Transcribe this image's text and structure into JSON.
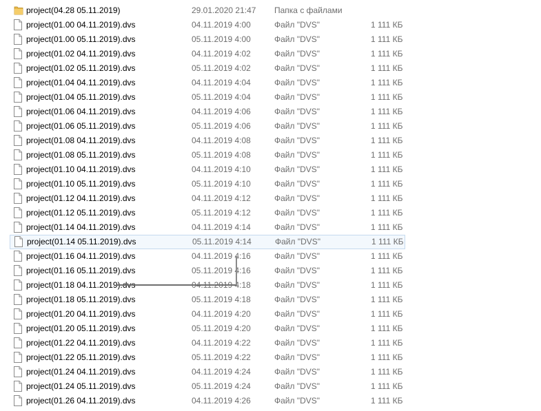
{
  "files": [
    {
      "name": "project(04.28 05.11.2019)",
      "date": "29.01.2020 21:47",
      "type": "Папка с файлами",
      "size": "",
      "icon": "folder-icon"
    },
    {
      "name": "project(01.00 04.11.2019).dvs",
      "date": "04.11.2019 4:00",
      "type": "Файл \"DVS\"",
      "size": "1 111 КБ",
      "icon": "file-icon"
    },
    {
      "name": "project(01.00 05.11.2019).dvs",
      "date": "05.11.2019 4:00",
      "type": "Файл \"DVS\"",
      "size": "1 111 КБ",
      "icon": "file-icon"
    },
    {
      "name": "project(01.02 04.11.2019).dvs",
      "date": "04.11.2019 4:02",
      "type": "Файл \"DVS\"",
      "size": "1 111 КБ",
      "icon": "file-icon"
    },
    {
      "name": "project(01.02 05.11.2019).dvs",
      "date": "05.11.2019 4:02",
      "type": "Файл \"DVS\"",
      "size": "1 111 КБ",
      "icon": "file-icon"
    },
    {
      "name": "project(01.04 04.11.2019).dvs",
      "date": "04.11.2019 4:04",
      "type": "Файл \"DVS\"",
      "size": "1 111 КБ",
      "icon": "file-icon"
    },
    {
      "name": "project(01.04 05.11.2019).dvs",
      "date": "05.11.2019 4:04",
      "type": "Файл \"DVS\"",
      "size": "1 111 КБ",
      "icon": "file-icon"
    },
    {
      "name": "project(01.06 04.11.2019).dvs",
      "date": "04.11.2019 4:06",
      "type": "Файл \"DVS\"",
      "size": "1 111 КБ",
      "icon": "file-icon"
    },
    {
      "name": "project(01.06 05.11.2019).dvs",
      "date": "05.11.2019 4:06",
      "type": "Файл \"DVS\"",
      "size": "1 111 КБ",
      "icon": "file-icon"
    },
    {
      "name": "project(01.08 04.11.2019).dvs",
      "date": "04.11.2019 4:08",
      "type": "Файл \"DVS\"",
      "size": "1 111 КБ",
      "icon": "file-icon"
    },
    {
      "name": "project(01.08 05.11.2019).dvs",
      "date": "05.11.2019 4:08",
      "type": "Файл \"DVS\"",
      "size": "1 111 КБ",
      "icon": "file-icon"
    },
    {
      "name": "project(01.10 04.11.2019).dvs",
      "date": "04.11.2019 4:10",
      "type": "Файл \"DVS\"",
      "size": "1 111 КБ",
      "icon": "file-icon"
    },
    {
      "name": "project(01.10 05.11.2019).dvs",
      "date": "05.11.2019 4:10",
      "type": "Файл \"DVS\"",
      "size": "1 111 КБ",
      "icon": "file-icon"
    },
    {
      "name": "project(01.12 04.11.2019).dvs",
      "date": "04.11.2019 4:12",
      "type": "Файл \"DVS\"",
      "size": "1 111 КБ",
      "icon": "file-icon"
    },
    {
      "name": "project(01.12 05.11.2019).dvs",
      "date": "05.11.2019 4:12",
      "type": "Файл \"DVS\"",
      "size": "1 111 КБ",
      "icon": "file-icon"
    },
    {
      "name": "project(01.14 04.11.2019).dvs",
      "date": "04.11.2019 4:14",
      "type": "Файл \"DVS\"",
      "size": "1 111 КБ",
      "icon": "file-icon"
    },
    {
      "name": "project(01.14 05.11.2019).dvs",
      "date": "05.11.2019 4:14",
      "type": "Файл \"DVS\"",
      "size": "1 111 КБ",
      "icon": "file-icon",
      "selected": true
    },
    {
      "name": "project(01.16 04.11.2019).dvs",
      "date": "04.11.2019 4:16",
      "type": "Файл \"DVS\"",
      "size": "1 111 КБ",
      "icon": "file-icon"
    },
    {
      "name": "project(01.16 05.11.2019).dvs",
      "date": "05.11.2019 4:16",
      "type": "Файл \"DVS\"",
      "size": "1 111 КБ",
      "icon": "file-icon"
    },
    {
      "name": "project(01.18 04.11.2019).dvs",
      "date": "04.11.2019 4:18",
      "type": "Файл \"DVS\"",
      "size": "1 111 КБ",
      "icon": "file-icon"
    },
    {
      "name": "project(01.18 05.11.2019).dvs",
      "date": "05.11.2019 4:18",
      "type": "Файл \"DVS\"",
      "size": "1 111 КБ",
      "icon": "file-icon"
    },
    {
      "name": "project(01.20 04.11.2019).dvs",
      "date": "04.11.2019 4:20",
      "type": "Файл \"DVS\"",
      "size": "1 111 КБ",
      "icon": "file-icon"
    },
    {
      "name": "project(01.20 05.11.2019).dvs",
      "date": "05.11.2019 4:20",
      "type": "Файл \"DVS\"",
      "size": "1 111 КБ",
      "icon": "file-icon"
    },
    {
      "name": "project(01.22 04.11.2019).dvs",
      "date": "04.11.2019 4:22",
      "type": "Файл \"DVS\"",
      "size": "1 111 КБ",
      "icon": "file-icon"
    },
    {
      "name": "project(01.22 05.11.2019).dvs",
      "date": "05.11.2019 4:22",
      "type": "Файл \"DVS\"",
      "size": "1 111 КБ",
      "icon": "file-icon"
    },
    {
      "name": "project(01.24 04.11.2019).dvs",
      "date": "04.11.2019 4:24",
      "type": "Файл \"DVS\"",
      "size": "1 111 КБ",
      "icon": "file-icon"
    },
    {
      "name": "project(01.24 05.11.2019).dvs",
      "date": "05.11.2019 4:24",
      "type": "Файл \"DVS\"",
      "size": "1 111 КБ",
      "icon": "file-icon"
    },
    {
      "name": "project(01.26 04.11.2019).dvs",
      "date": "04.11.2019 4:26",
      "type": "Файл \"DVS\"",
      "size": "1 111 КБ",
      "icon": "file-icon"
    }
  ],
  "colors": {
    "text": "#000000",
    "secondary_text": "#6d6d6d",
    "selection_border": "#c5d9ee",
    "selection_fill": "#f3f8fd",
    "folder": "#e8b84a"
  }
}
